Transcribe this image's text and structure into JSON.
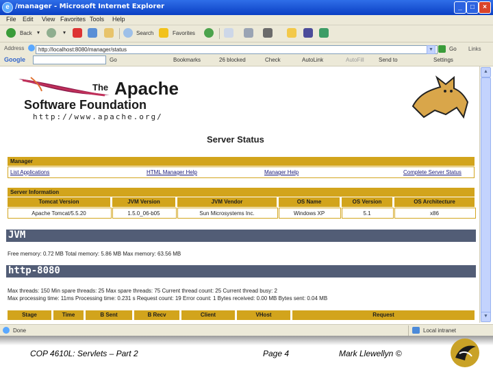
{
  "window": {
    "title": "/manager - Microsoft Internet Explorer"
  },
  "menu": [
    "File",
    "Edit",
    "View",
    "Favorites",
    "Tools",
    "Help"
  ],
  "toolbar": {
    "back": "Back",
    "search": "Search",
    "favorites": "Favorites"
  },
  "address": {
    "label": "Address",
    "url": "http://localhost:8080/manager/status",
    "go": "Go",
    "links": "Links"
  },
  "google_bar": {
    "label": "Google",
    "go": "Go",
    "bookmarks": "Bookmarks",
    "blocked": "26 blocked",
    "check": "Check",
    "autolink": "AutoLink",
    "autofill": "AutoFill",
    "sendto": "Send to",
    "settings": "Settings"
  },
  "page": {
    "logo": {
      "the": "The",
      "apache": "Apache",
      "sf": "Software Foundation",
      "url": "http://www.apache.org/"
    },
    "heading": "Server Status",
    "manager": {
      "title": "Manager",
      "links": [
        "List Applications",
        "HTML Manager Help",
        "Manager Help",
        "Complete Server Status"
      ]
    },
    "server_info": {
      "title": "Server Information",
      "headers": [
        "Tomcat Version",
        "JVM Version",
        "JVM Vendor",
        "OS Name",
        "OS Version",
        "OS Architecture"
      ],
      "values": [
        "Apache Tomcat/5.5.20",
        "1.5.0_06-b05",
        "Sun Microsystems Inc.",
        "Windows XP",
        "5.1",
        "x86"
      ]
    },
    "jvm": {
      "title": "JVM",
      "memory": "Free memory: 0.72 MB Total memory: 5.86 MB Max memory: 63.56 MB"
    },
    "connector": {
      "title": "http-8080",
      "line1": "Max threads: 150 Min spare threads: 25 Max spare threads: 75 Current thread count: 25 Current thread busy: 2",
      "line2": "Max processing time: 11ms Processing time: 0.231 s Request count: 19 Error count: 1 Bytes received: 0.00 MB Bytes sent: 0.04 MB",
      "headers": [
        "Stage",
        "Time",
        "B Sent",
        "B Recv",
        "Client",
        "VHost",
        "Request"
      ]
    }
  },
  "status": {
    "text": "Done",
    "zone": "Local intranet"
  },
  "footer": {
    "course": "COP 4610L: Servlets – Part 2",
    "page": "Page 4",
    "author": "Mark Llewellyn ©"
  },
  "colors": {
    "section_bar": "#525d76",
    "gold": "#d2a41c",
    "titlebar": "#0a3fc4",
    "feather": "#8b1a4a"
  }
}
